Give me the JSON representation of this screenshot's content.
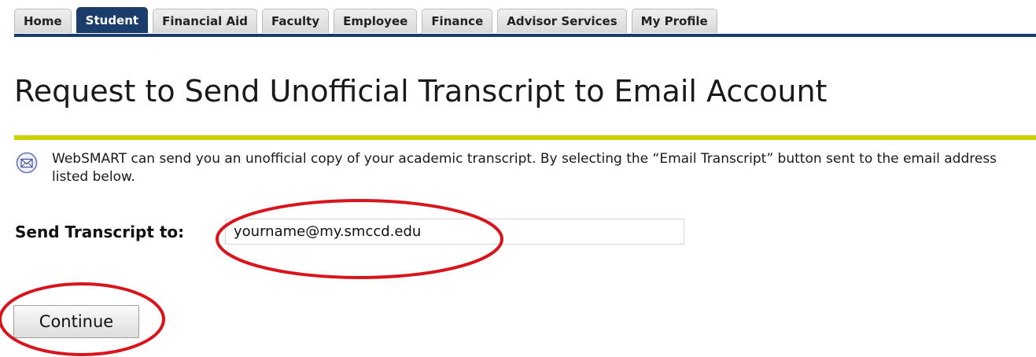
{
  "tabs": [
    {
      "label": "Home",
      "active": false
    },
    {
      "label": "Student",
      "active": true
    },
    {
      "label": "Financial Aid",
      "active": false
    },
    {
      "label": "Faculty",
      "active": false
    },
    {
      "label": "Employee",
      "active": false
    },
    {
      "label": "Finance",
      "active": false
    },
    {
      "label": "Advisor Services",
      "active": false
    },
    {
      "label": "My Profile",
      "active": false
    }
  ],
  "page": {
    "title": "Request to Send Unofficial Transcript to Email Account"
  },
  "info": {
    "icon": "envelope-icon",
    "text": "WebSMART can send you an unofficial copy of your academic transcript. By selecting the “Email Transcript” button sent to the email address listed below."
  },
  "form": {
    "send_label": "Send Transcript to:",
    "email_value": "yourname@my.smccd.edu",
    "continue_label": "Continue"
  },
  "colors": {
    "tab_active": "#1a3d6b",
    "title_rule": "#c9d400",
    "annotation": "#d8141c"
  }
}
